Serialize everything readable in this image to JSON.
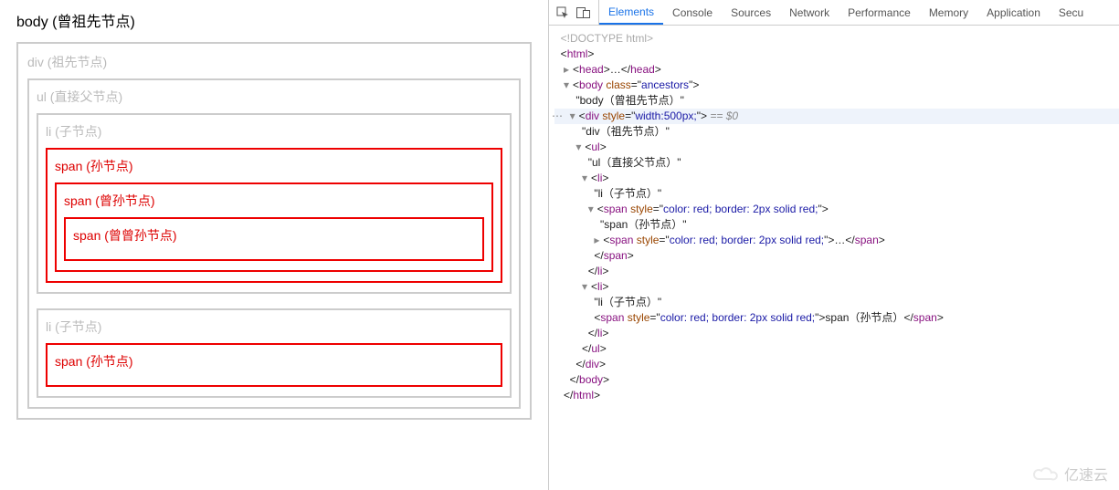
{
  "page": {
    "body_label": "body (曾祖先节点)",
    "div_label": "div (祖先节点)",
    "ul_label": "ul (直接父节点)",
    "li1_label": "li (子节点)",
    "span1_label": "span (孙节点)",
    "span2_label": "span (曾孙节点)",
    "span3_label": "span (曾曾孙节点)",
    "li2_label": "li (子节点)",
    "span4_label": "span (孙节点)"
  },
  "devtools": {
    "tabs": {
      "elements": "Elements",
      "console": "Console",
      "sources": "Sources",
      "network": "Network",
      "performance": "Performance",
      "memory": "Memory",
      "application": "Application",
      "security": "Secu"
    },
    "dom": {
      "doctype": "<!DOCTYPE html>",
      "html_open": "html",
      "head": "head",
      "body_open_tag": "body",
      "body_class_name": "class",
      "body_class_val": "ancestors",
      "body_text": "\"body（曾祖先节点）\"",
      "div_tag": "div",
      "div_style_name": "style",
      "div_style_val": "width:500px;",
      "div_sel_suffix": " == $0",
      "div_text": "\"div（祖先节点）\"",
      "ul_tag": "ul",
      "ul_text": "\"ul（直接父节点）\"",
      "li_tag": "li",
      "li1_text": "\"li（子节点）\"",
      "span_tag": "span",
      "span_style_name": "style",
      "span_style_val": "color: red; border: 2px solid red;",
      "span1_text": "\"span（孙节点）\"",
      "span2_collapsed_mid": "…",
      "li2_text": "\"li（子节点）\"",
      "span4_inline_text": "span（孙节点）",
      "close_span": "span",
      "close_li": "li",
      "close_ul": "ul",
      "close_div": "div",
      "close_body": "body",
      "close_html": "html"
    }
  },
  "watermark": "亿速云"
}
